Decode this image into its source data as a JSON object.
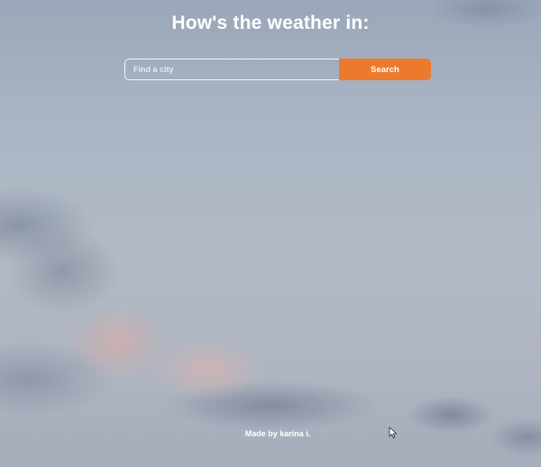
{
  "header": {
    "title": "How's the weather in:"
  },
  "search": {
    "placeholder": "Find a city",
    "value": "",
    "button_label": "Search"
  },
  "footer": {
    "credit": "Made by karina i."
  },
  "colors": {
    "accent": "#ec7a2e",
    "text": "#ffffff"
  },
  "icons": {
    "cursor": "mouse-pointer-icon"
  }
}
